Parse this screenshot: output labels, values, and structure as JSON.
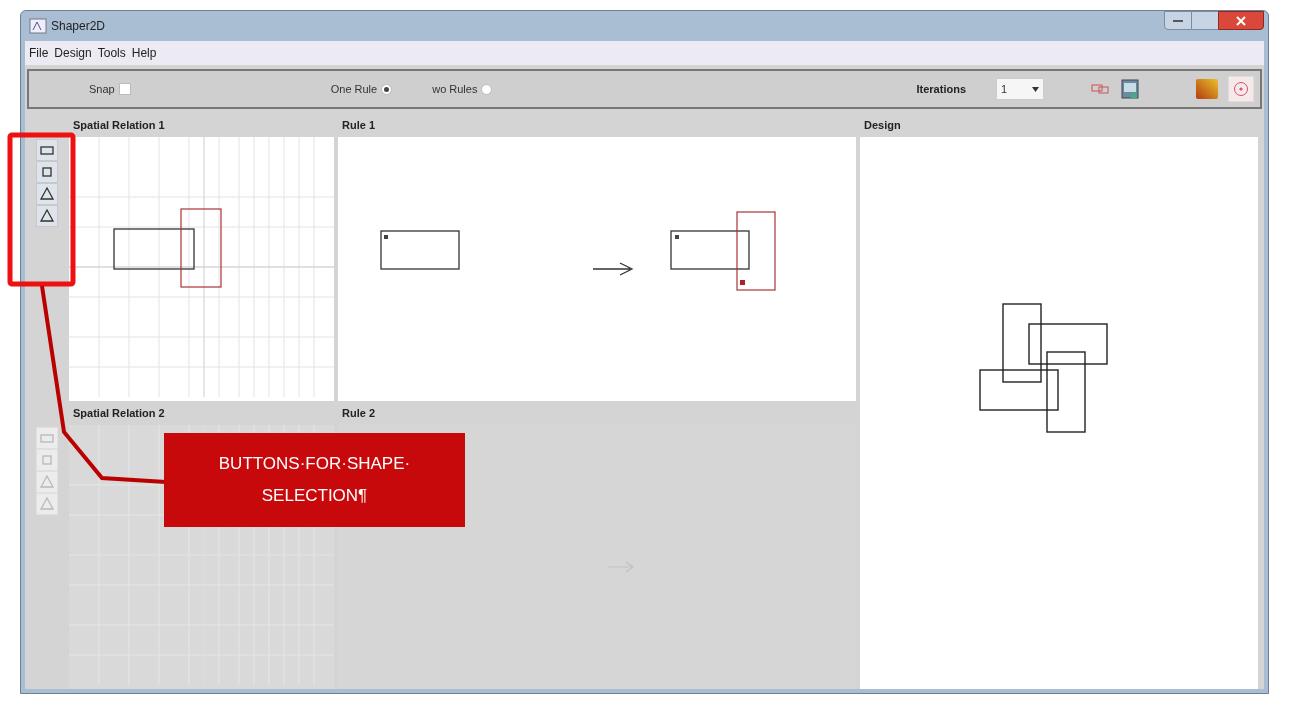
{
  "window": {
    "title": "Shaper2D"
  },
  "menu": [
    "File",
    "Design",
    "Tools",
    "Help"
  ],
  "toolbar": {
    "snap": {
      "label": "Snap",
      "checked": false
    },
    "rule_modes": [
      {
        "label": "One Rule",
        "selected": true
      },
      {
        "label": "wo Rules",
        "selected": false
      }
    ],
    "iterations": {
      "label": "Iterations",
      "value": "1"
    }
  },
  "rows": [
    {
      "spatial_title": "Spatial Relation 1",
      "rule_title": "Rule 1",
      "disabled": false,
      "buttons": [
        {
          "kind": "rectangle"
        },
        {
          "kind": "square"
        },
        {
          "kind": "triangle"
        },
        {
          "kind": "triangle"
        }
      ]
    },
    {
      "spatial_title": "Spatial Relation 2",
      "rule_title": "Rule 2",
      "disabled": true,
      "buttons": [
        {
          "kind": "rectangle"
        },
        {
          "kind": "square"
        },
        {
          "kind": "triangle"
        },
        {
          "kind": "triangle"
        }
      ]
    }
  ],
  "design": {
    "title": "Design"
  },
  "annotation": {
    "text": "BUTTONS·FOR·SHAPE·SELECTION¶"
  }
}
